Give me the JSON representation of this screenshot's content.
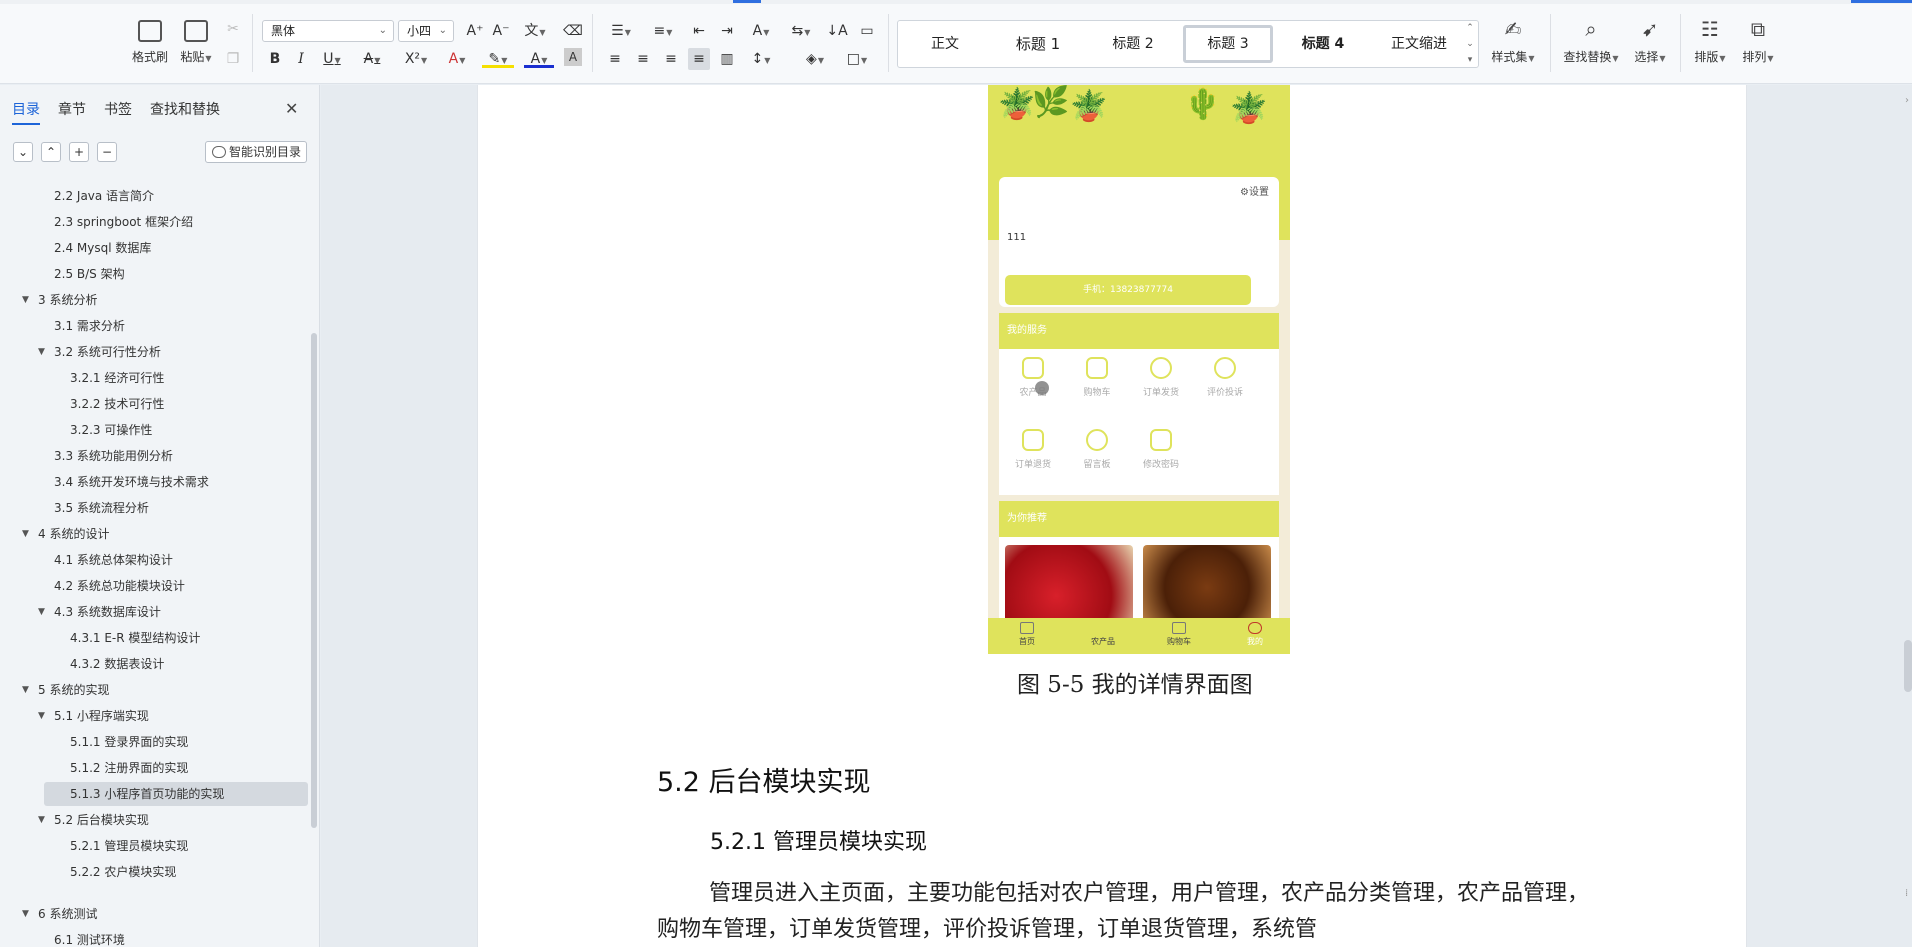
{
  "ribbon": {
    "format_painter": "格式刷",
    "paste": "粘贴",
    "font_name": "黑体",
    "font_size": "小四",
    "styles": [
      "正文",
      "标题 1",
      "标题 2",
      "标题 3",
      "标题 4",
      "正文缩进"
    ],
    "style_set": "样式集",
    "find_replace": "查找替换",
    "select": "选择",
    "layout": "排版",
    "arrange": "排列"
  },
  "nav": {
    "tabs": [
      "目录",
      "章节",
      "书签",
      "查找和替换"
    ],
    "smart_toc": "智能识别目录",
    "toc": [
      {
        "label": "2.2 Java 语言简介",
        "level": 2
      },
      {
        "label": "2.3 springboot 框架介绍",
        "level": 2
      },
      {
        "label": "2.4 Mysql 数据库",
        "level": 2
      },
      {
        "label": "2.5 B/S 架构",
        "level": 2
      },
      {
        "label": "3   系统分析",
        "level": 1
      },
      {
        "label": "3.1 需求分析",
        "level": 2
      },
      {
        "label": "3.2  系统可行性分析",
        "level": 2
      },
      {
        "label": "3.2.1 经济可行性",
        "level": 3
      },
      {
        "label": "3.2.2 技术可行性",
        "level": 3
      },
      {
        "label": "3.2.3 可操作性",
        "level": 3
      },
      {
        "label": "3.3 系统功能用例分析",
        "level": 2
      },
      {
        "label": "3.4 系统开发环境与技术需求",
        "level": 2
      },
      {
        "label": "3.5 系统流程分析",
        "level": 2
      },
      {
        "label": "4   系统的设计",
        "level": 1
      },
      {
        "label": "4.1  系统总体架构设计",
        "level": 2
      },
      {
        "label": "4.2  系统总功能模块设计",
        "level": 2
      },
      {
        "label": "4.3 系统数据库设计",
        "level": 2
      },
      {
        "label": "4.3.1 E-R 模型结构设计",
        "level": 3
      },
      {
        "label": "4.3.2 数据表设计",
        "level": 3
      },
      {
        "label": "5   系统的实现",
        "level": 1
      },
      {
        "label": "5.1 小程序端实现",
        "level": 2
      },
      {
        "label": "5.1.1 登录界面的实现",
        "level": 3
      },
      {
        "label": "5.1.2 注册界面的实现",
        "level": 3
      },
      {
        "label": "5.1.3  小程序首页功能的实现",
        "level": 3
      },
      {
        "label": "5.2 后台模块实现",
        "level": 2
      },
      {
        "label": "5.2.1 管理员模块实现",
        "level": 3
      },
      {
        "label": "5.2.2 农户模块实现",
        "level": 3
      },
      {
        "label": "6 系统测试",
        "level": 1
      },
      {
        "label": "6.1 测试环境",
        "level": 2
      }
    ]
  },
  "phone": {
    "settings": "设置",
    "username": "111",
    "phone_line": "手机：13823877774",
    "my_services_title": "我的服务",
    "services": [
      "农产品",
      "购物车",
      "订单发货",
      "评价投诉",
      "订单退货",
      "留言板",
      "修改密码"
    ],
    "recommend_title": "为你推荐",
    "bottom_nav": [
      "首页",
      "农产品",
      "购物车",
      "我的"
    ]
  },
  "document": {
    "caption": "图 5-5 我的详情界面图",
    "heading2": "5.2 后台模块实现",
    "heading3": "5.2.1 管理员模块实现",
    "paragraph": "管理员进入主页面，主要功能包括对农户管理，用户管理，农产品分类管理，农产品管理，购物车管理，订单发货管理，评价投诉管理，订单退货管理，系统管"
  },
  "colors": {
    "accent": "#1d64d8",
    "phone_theme": "#dfe35c"
  }
}
